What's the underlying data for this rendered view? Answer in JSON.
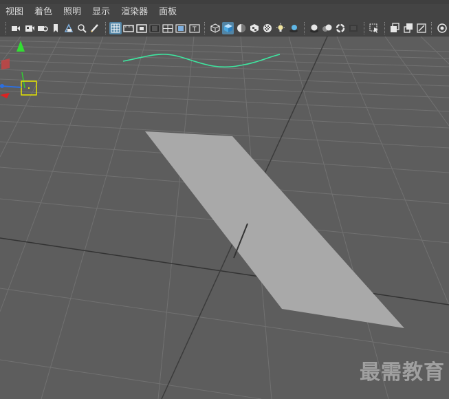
{
  "menubar": {
    "items": [
      "视图",
      "着色",
      "照明",
      "显示",
      "渲染器",
      "面板"
    ]
  },
  "toolbar": {
    "groups": [
      [
        "camera-icon",
        "camera-attributes-icon",
        "camera-bookmark-icon",
        "bookmark-icon",
        "image-plane-icon",
        "2d-pan-zoom-icon",
        "grease-pencil-icon"
      ],
      [
        "grid-icon",
        "film-gate-icon",
        "resolution-gate-icon",
        "gate-mask-icon",
        "field-chart-icon",
        "safe-action-icon"
      ],
      [
        "wireframe-icon",
        "smooth-shade-icon",
        "default-material-icon",
        "textured-icon",
        "xray-icon",
        "lights-icon",
        "shadows-icon"
      ],
      [
        "ambient-occlusion-icon",
        "motion-blur-icon",
        "antialias-icon",
        "depth-of-field-icon"
      ],
      [
        "isolate-select-icon"
      ],
      [
        "xray-joints-icon",
        "xray-active-icon",
        "backface-icon"
      ],
      [
        "color-management-icon"
      ]
    ],
    "active": [
      "grid-icon",
      "smooth-shade-icon"
    ]
  },
  "viewport": {
    "object": "plane",
    "curve_color": "#3ee6a0",
    "plane_color": "#a9a9a9",
    "grid_color": "#717171",
    "background": "#5d5d5d"
  },
  "watermark": {
    "text": "最需教育"
  }
}
